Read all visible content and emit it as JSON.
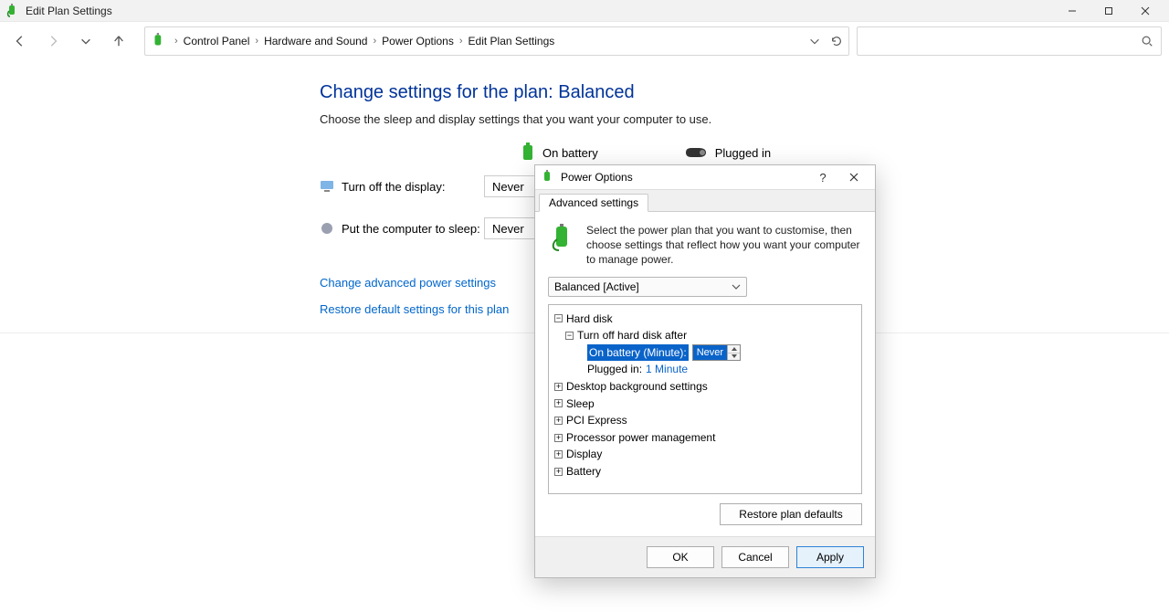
{
  "titlebar": {
    "title": "Edit Plan Settings"
  },
  "breadcrumbs": [
    "Control Panel",
    "Hardware and Sound",
    "Power Options",
    "Edit Plan Settings"
  ],
  "main": {
    "heading": "Change settings for the plan: Balanced",
    "subtext": "Choose the sleep and display settings that you want your computer to use.",
    "columns": {
      "battery": "On battery",
      "plugged": "Plugged in"
    },
    "rows": {
      "display": {
        "label": "Turn off the display:",
        "battery_value": "Never"
      },
      "sleep": {
        "label": "Put the computer to sleep:",
        "battery_value": "Never"
      }
    },
    "links": {
      "advanced": "Change advanced power settings",
      "restore": "Restore default settings for this plan"
    }
  },
  "dialog": {
    "title": "Power Options",
    "tab": "Advanced settings",
    "description": "Select the power plan that you want to customise, then choose settings that reflect how you want your computer to manage power.",
    "plan": "Balanced [Active]",
    "tree": {
      "hard_disk": "Hard disk",
      "turn_off": "Turn off hard disk after",
      "on_battery_label": "On battery (Minute):",
      "on_battery_value": "Never",
      "plugged_label": "Plugged in:",
      "plugged_value": "1 Minute",
      "desktop_bg": "Desktop background settings",
      "sleep": "Sleep",
      "pci": "PCI Express",
      "processor": "Processor power management",
      "display": "Display",
      "battery": "Battery"
    },
    "buttons": {
      "restore": "Restore plan defaults",
      "ok": "OK",
      "cancel": "Cancel",
      "apply": "Apply"
    }
  }
}
